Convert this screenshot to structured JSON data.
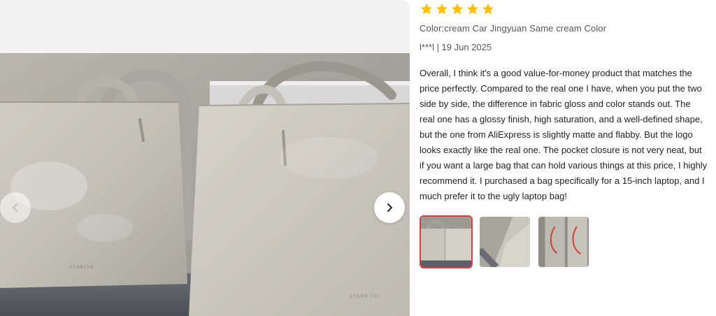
{
  "gallery": {
    "prev_icon": "chevron-left-icon",
    "next_icon": "chevron-right-icon",
    "photo": {
      "left_bag_logo": "CIABIOR",
      "right_bag_logo": "STANB CIL"
    }
  },
  "review": {
    "rating": 5,
    "star_color": "#FFC107",
    "color_line": "Color:cream Car Jingyuan Same cream Color",
    "author": "l***l",
    "date": "19 Jun 2025",
    "meta": "l***l | 19 Jun 2025",
    "text": "Overall, I think it's a good value-for-money product that matches the price perfectly. Compared to the real one I have, when you put the two side by side, the difference in fabric gloss and color stands out. The real one has a glossy finish, high saturation, and a well-defined shape, but the one from AliExpress is slightly matte and flabby. But the logo looks exactly like the real one. The pocket closure is not very neat, but if you want a large bag that can hold various things at this price, I highly recommend it. I purchased a bag specifically for a 15-inch laptop, and I much prefer it to the ugly laptop bag!",
    "thumbnails": [
      {
        "name": "thumbnail-1",
        "selected": true
      },
      {
        "name": "thumbnail-2",
        "selected": false
      },
      {
        "name": "thumbnail-3",
        "selected": false
      }
    ]
  },
  "colors": {
    "accent_border": "#E4393C",
    "bag_color": "#D9D6CD",
    "sofa_color": "#5C5F66"
  }
}
